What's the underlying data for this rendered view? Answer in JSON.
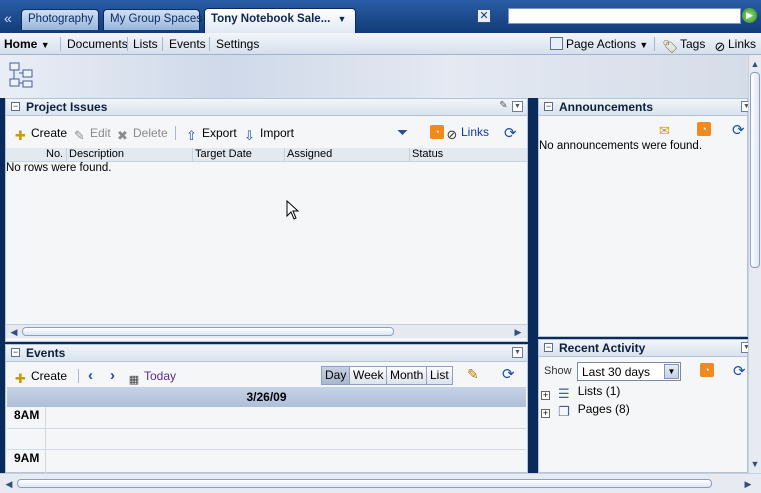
{
  "tabs": {
    "back_glyph": "«",
    "items": [
      "Photography",
      "My Group Spaces"
    ],
    "active": "Tony Notebook Sale...",
    "active_arrow": "▼"
  },
  "search": {
    "value": ""
  },
  "nav": {
    "home": "Home",
    "items": [
      "Documents",
      "Lists",
      "Events",
      "Settings"
    ],
    "page_actions": "Page Actions",
    "tags": "Tags",
    "links": "Links"
  },
  "project_issues": {
    "title": "Project Issues",
    "toolbar": {
      "create": "Create",
      "edit": "Edit",
      "delete": "Delete",
      "export": "Export",
      "import": "Import",
      "links": "Links"
    },
    "columns": [
      "No.",
      "Description",
      "Target Date",
      "Assigned",
      "Status"
    ],
    "empty_message": "No rows were found."
  },
  "events": {
    "title": "Events",
    "create": "Create",
    "today": "Today",
    "views": [
      "Day",
      "Week",
      "Month",
      "List"
    ],
    "selected_view": "Day",
    "date": "3/26/09",
    "hours": [
      "8AM",
      "9AM"
    ]
  },
  "announcements": {
    "title": "Announcements",
    "empty_message": "No announcements were found."
  },
  "recent_activity": {
    "title": "Recent Activity",
    "show_label": "Show",
    "range": "Last 30 days",
    "items": [
      "Lists (1)",
      "Pages (8)"
    ]
  },
  "colors": {
    "accent": "#123b78",
    "link": "#0b3a9a",
    "today": "#5a2a9a"
  }
}
